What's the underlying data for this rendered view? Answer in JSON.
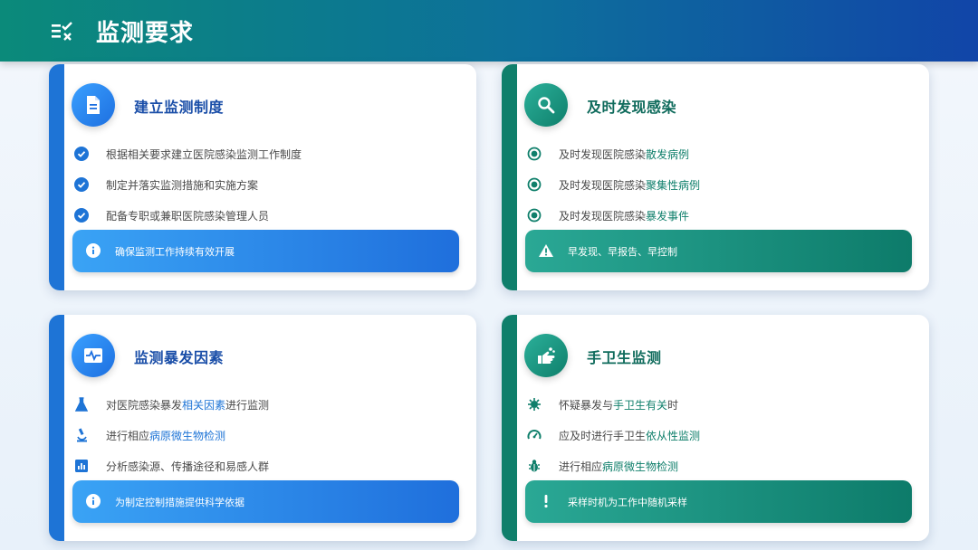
{
  "header": {
    "title": "监测要求",
    "icon": "checklist-icon"
  },
  "cards": [
    {
      "title": "建立监测制度",
      "icon": "document-icon",
      "items": [
        {
          "icon": "check-circle-icon",
          "pre": "根据相关要求建立医院感染监测工作制度",
          "hl": "",
          "post": ""
        },
        {
          "icon": "check-circle-icon",
          "pre": "制定并落实监测措施和实施方案",
          "hl": "",
          "post": ""
        },
        {
          "icon": "check-circle-icon",
          "pre": "配备专职或兼职医院感染管理人员",
          "hl": "",
          "post": ""
        }
      ],
      "banner": {
        "icon": "info-icon",
        "text": "确保监测工作持续有效开展"
      }
    },
    {
      "title": "及时发现感染",
      "icon": "search-icon",
      "items": [
        {
          "icon": "radio-dot-icon",
          "pre": "及时发现医院感染",
          "hl": "散发病例",
          "post": ""
        },
        {
          "icon": "radio-dot-icon",
          "pre": "及时发现医院感染",
          "hl": "聚集性病例",
          "post": ""
        },
        {
          "icon": "radio-dot-icon",
          "pre": "及时发现医院感染",
          "hl": "暴发事件",
          "post": ""
        }
      ],
      "banner": {
        "icon": "warning-icon",
        "text": "早发现、早报告、早控制"
      }
    },
    {
      "title": "监测暴发因素",
      "icon": "heartbeat-monitor-icon",
      "items": [
        {
          "icon": "flask-icon",
          "pre": "对医院感染暴发",
          "hl": "相关因素",
          "post": "进行监测"
        },
        {
          "icon": "microscope-icon",
          "pre": "进行相应",
          "hl": "病原微生物检测",
          "post": ""
        },
        {
          "icon": "bar-chart-icon",
          "pre": "分析感染源、传播途径和易感人群",
          "hl": "",
          "post": ""
        }
      ],
      "banner": {
        "icon": "info-icon",
        "text": "为制定控制措施提供科学依据"
      }
    },
    {
      "title": "手卫生监测",
      "icon": "hand-wash-icon",
      "items": [
        {
          "icon": "virus-icon",
          "pre": "怀疑暴发与",
          "hl": "手卫生有关",
          "post": "时"
        },
        {
          "icon": "gauge-icon",
          "pre": "应及时进行手卫生",
          "hl": "依从性监测",
          "post": ""
        },
        {
          "icon": "bug-icon",
          "pre": "进行相应",
          "hl": "病原微生物检测",
          "post": ""
        }
      ],
      "banner": {
        "icon": "exclamation-icon",
        "text": "采样时机为工作中随机采样"
      }
    }
  ]
}
